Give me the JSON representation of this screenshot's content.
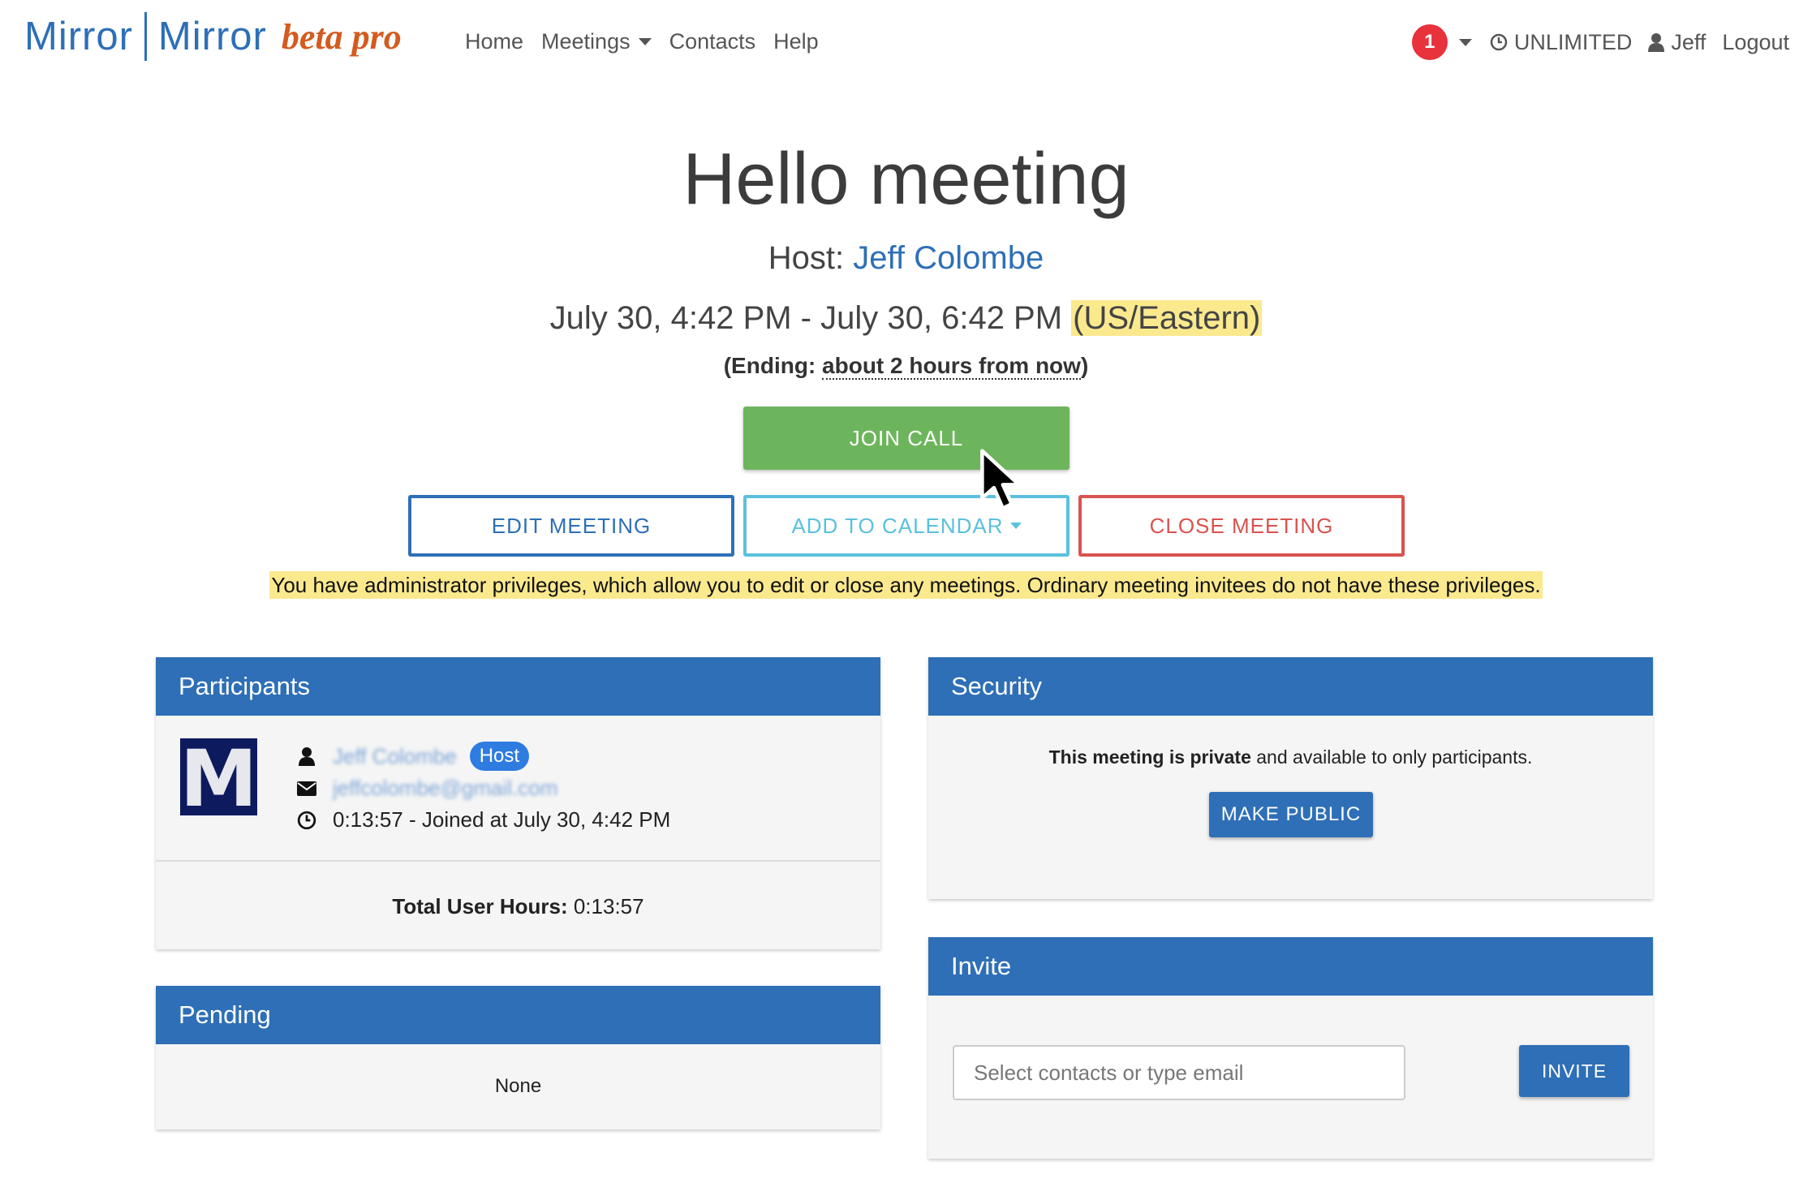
{
  "logo": {
    "word1": "Mirror",
    "word2": "Mirror",
    "suffix": "beta pro"
  },
  "nav": {
    "home": "Home",
    "meetings": "Meetings",
    "contacts": "Contacts",
    "help": "Help"
  },
  "nav_right": {
    "notifications_count": "1",
    "plan": "UNLIMITED",
    "user": "Jeff",
    "logout": "Logout"
  },
  "meeting": {
    "title": "Hello meeting",
    "host_label": "Host:",
    "host_name": "Jeff Colombe",
    "time_range": "July 30, 4:42 PM - July 30, 6:42 PM",
    "timezone": "(US/Eastern)",
    "ending_label": "(Ending:",
    "ending_relative": "about 2 hours from now",
    "ending_close": ")"
  },
  "actions": {
    "join": "JOIN CALL",
    "edit": "EDIT MEETING",
    "calendar": "ADD TO CALENDAR",
    "close": "CLOSE MEETING"
  },
  "admin_note": "You have administrator privileges, which allow you to edit or close any meetings. Ordinary meeting invitees do not have these privileges.",
  "participants": {
    "heading": "Participants",
    "items": [
      {
        "avatar_letter": "M",
        "name": "Jeff Colombe",
        "role": "Host",
        "email": "jeffcolombe@gmail.com",
        "session": "0:13:57 - Joined at July 30, 4:42 PM"
      }
    ],
    "total_label": "Total User Hours:",
    "total_value": "0:13:57"
  },
  "pending": {
    "heading": "Pending",
    "value": "None"
  },
  "security": {
    "heading": "Security",
    "status_strong": "This meeting is private",
    "status_rest": " and available to only participants.",
    "make_public": "MAKE PUBLIC"
  },
  "invite": {
    "heading": "Invite",
    "placeholder": "Select contacts or type email",
    "button": "INVITE"
  },
  "colors": {
    "primary": "#2e6fb7",
    "success": "#6db55c",
    "info": "#5bc0de",
    "danger": "#d9534f",
    "highlight": "#fbe98e",
    "badge": "#e8323c"
  },
  "icons": [
    "user-icon",
    "envelope-icon",
    "clock-icon",
    "caret-down-icon",
    "mouse-pointer-icon"
  ]
}
